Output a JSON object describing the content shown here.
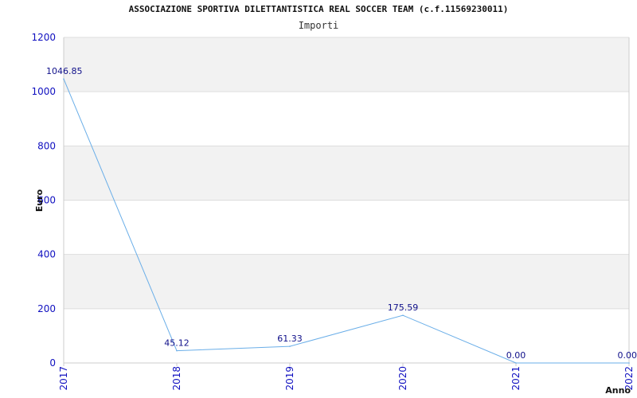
{
  "chart_data": {
    "type": "line",
    "title": "ASSOCIAZIONE SPORTIVA DILETTANTISTICA REAL SOCCER TEAM (c.f.11569230011)",
    "subtitle": "Importi",
    "xlabel": "Anno",
    "ylabel": "Euro",
    "categories": [
      "2017",
      "2018",
      "2019",
      "2020",
      "2021",
      "2022"
    ],
    "series": [
      {
        "values": [
          1046.85,
          45.12,
          61.33,
          175.59,
          0.0,
          0.0
        ],
        "labels": [
          "1046.85",
          "45.12",
          "61.33",
          "175.59",
          "0.00",
          "0.00"
        ]
      }
    ],
    "ylim": [
      0,
      1200
    ],
    "yticks": [
      "0",
      "200",
      "400",
      "600",
      "800",
      "1000",
      "1200"
    ],
    "grid": true,
    "colors": {
      "line": "#6aaee8",
      "band": "#f2f2f2",
      "grid": "#dddddd",
      "ticks": "#1010c0",
      "labels": "#10108a"
    }
  }
}
